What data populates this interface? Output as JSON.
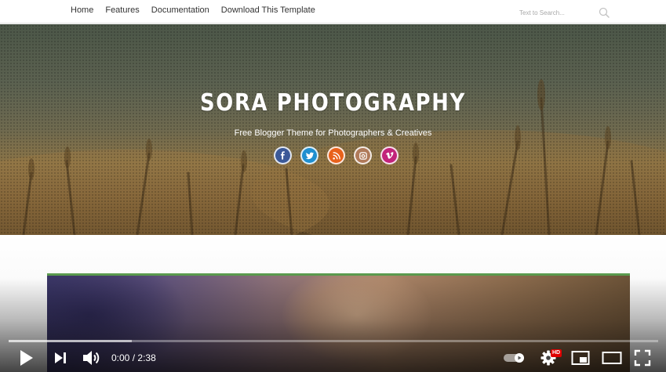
{
  "nav": {
    "links": [
      "Home",
      "Features",
      "Documentation",
      "Download This Template"
    ],
    "search_placeholder": "Text to Search..."
  },
  "hero": {
    "title": "SORA PHOTOGRAPHY",
    "tagline": "Free Blogger Theme for Photographers & Creatives",
    "socials": [
      {
        "name": "facebook-icon",
        "color": "#3b5998"
      },
      {
        "name": "twitter-icon",
        "color": "#1f8fd0"
      },
      {
        "name": "rss-icon",
        "color": "#e8611b"
      },
      {
        "name": "instagram-icon",
        "color": "#b07a5a"
      },
      {
        "name": "vimeo-icon",
        "color": "#c2227a"
      }
    ]
  },
  "colors": {
    "post_border": "#5a9a4e",
    "progress_played": "#ff0000"
  },
  "player": {
    "current_time": "0:00",
    "separator": "/",
    "duration": "2:38",
    "hd_label": "HD",
    "progress_played": 0,
    "progress_loaded": 0.19
  }
}
